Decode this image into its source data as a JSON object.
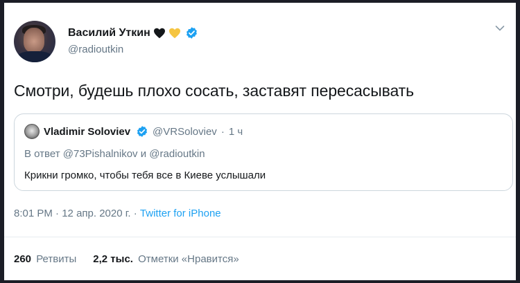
{
  "author": {
    "name": "Василий Уткин",
    "handle": "@radioutkin",
    "hearts": [
      "black",
      "yellow"
    ],
    "verified": true
  },
  "tweet": {
    "text": "Смотри, будешь плохо сосать, заставят пересасывать"
  },
  "quote": {
    "name": "Vladimir Soloviev",
    "handle": "@VRSoloviev",
    "separator": "·",
    "time": "1 ч",
    "reply_prefix": "В ответ",
    "reply_user1": "@73Pishalnikov",
    "reply_and": "и",
    "reply_user2": "@radioutkin",
    "text": "Крикни громко, чтобы тебя все в Киеве услышали"
  },
  "meta": {
    "time": "8:01 PM",
    "sep1": "·",
    "date": "12 апр. 2020 г.",
    "sep2": "·",
    "source": "Twitter for iPhone"
  },
  "stats": {
    "retweets_count": "260",
    "retweets_label": "Ретвиты",
    "likes_count": "2,2 тыс.",
    "likes_label": "Отметки «Нравится»"
  },
  "colors": {
    "accent": "#1da1f2",
    "secondary_text": "#657786",
    "verified": "#1da1f2",
    "heart_black": "#14171a",
    "heart_yellow": "#f5c542"
  },
  "icons": [
    "verified-badge-icon",
    "black-heart-icon",
    "yellow-heart-icon",
    "chevron-down-icon"
  ]
}
